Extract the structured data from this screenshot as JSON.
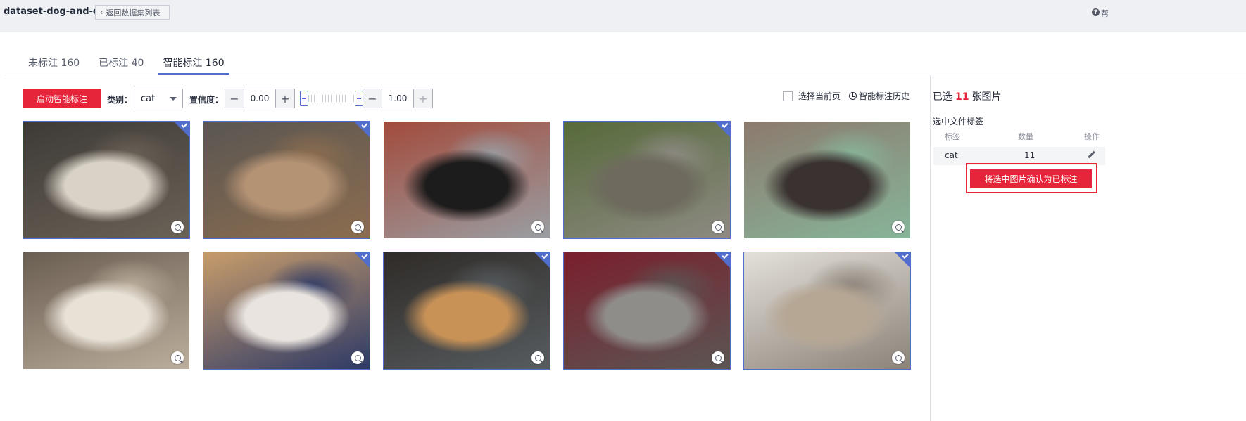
{
  "header": {
    "dataset_name": "dataset-dog-and-cat",
    "back_label": "返回数据集列表",
    "help_label": "帮"
  },
  "tabs": [
    {
      "label": "未标注 160",
      "active": false
    },
    {
      "label": "已标注 40",
      "active": false
    },
    {
      "label": "智能标注 160",
      "active": true
    }
  ],
  "toolbar": {
    "start_label": "启动智能标注",
    "category_label": "类别：",
    "category_value": "cat",
    "confidence_label": "置信度：",
    "min_value": "0.00",
    "max_value": "1.00",
    "minus": "−",
    "plus": "+",
    "select_page_label": "选择当前页",
    "history_label": "智能标注历史"
  },
  "images": [
    {
      "subject": "cat",
      "selected": true,
      "colors": [
        "#3d3a36",
        "#d8d2c7",
        "#6b6257"
      ]
    },
    {
      "subject": "cat",
      "selected": true,
      "colors": [
        "#5a5652",
        "#b49274",
        "#8c6d4f"
      ]
    },
    {
      "subject": "dog",
      "selected": false,
      "colors": [
        "#a24b3c",
        "#1d1c1c",
        "#9a9ea3"
      ]
    },
    {
      "subject": "cat",
      "selected": true,
      "colors": [
        "#566a3a",
        "#6e6a5e",
        "#8d8a83"
      ]
    },
    {
      "subject": "person-with-dog",
      "selected": false,
      "colors": [
        "#8c7a6e",
        "#3a3230",
        "#87b59a"
      ]
    },
    {
      "subject": "cat",
      "selected": false,
      "colors": [
        "#6a5e52",
        "#e7e1d6",
        "#bcae9c"
      ]
    },
    {
      "subject": "cat",
      "selected": true,
      "colors": [
        "#c79c6b",
        "#e9e4df",
        "#2e3a66"
      ]
    },
    {
      "subject": "cat",
      "selected": true,
      "colors": [
        "#2f2b28",
        "#c89257",
        "#575c5f"
      ]
    },
    {
      "subject": "cat",
      "selected": true,
      "colors": [
        "#7a1f2d",
        "#8f8d8a",
        "#5b5653"
      ]
    },
    {
      "subject": "cat",
      "selected": true,
      "colors": [
        "#e3e0da",
        "#b6a794",
        "#8c8379"
      ]
    }
  ],
  "sidebar": {
    "selected_prefix": "已选",
    "selected_count": "11",
    "selected_suffix": "张图片",
    "tag_title": "选中文件标签",
    "columns": [
      "标签",
      "数量",
      "操作"
    ],
    "rows": [
      {
        "tag": "cat",
        "count": "11"
      }
    ],
    "confirm_label": "将选中图片确认为已标注"
  },
  "colors": {
    "accent": "#526ecc",
    "danger": "#e6253a"
  }
}
